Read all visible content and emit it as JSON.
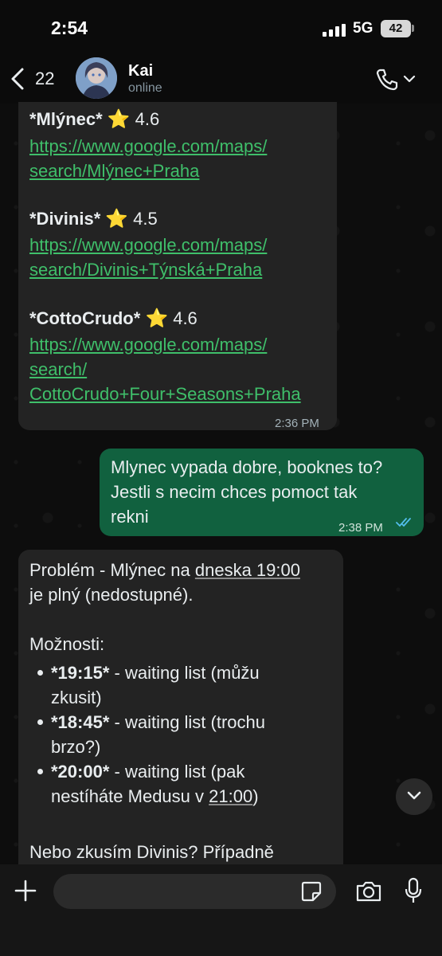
{
  "status_bar": {
    "time": "2:54",
    "network": "5G",
    "battery": "42"
  },
  "header": {
    "back_count": "22",
    "contact_name": "Kai",
    "contact_status": "online"
  },
  "messages": [
    {
      "direction": "incoming",
      "entries": [
        {
          "name": "*Mlýnec*",
          "star": "⭐",
          "rating": "4.6",
          "link_lines": [
            "https://www.google.com/maps/",
            "search/Mlýnec+Praha"
          ]
        },
        {
          "name": "*Divinis*",
          "star": "⭐",
          "rating": "4.5",
          "link_lines": [
            "https://www.google.com/maps/",
            "search/Divinis+Týnská+Praha"
          ]
        },
        {
          "name": "*CottoCrudo*",
          "star": "⭐",
          "rating": "4.6",
          "link_lines": [
            "https://www.google.com/maps/",
            "search/",
            "CottoCrudo+Four+Seasons+Praha"
          ]
        }
      ],
      "time": "2:36 PM"
    },
    {
      "direction": "outgoing",
      "lines": [
        "Mlynec vypada dobre, booknes to?",
        "Jestli s necim chces pomoct tak",
        "rekni"
      ],
      "time": "2:38 PM",
      "status": "read"
    },
    {
      "direction": "incoming",
      "intro_prefix": "Problém - Mlýnec na ",
      "intro_link": "dneska 19:00",
      "intro_line2": "je plný (nedostupné).",
      "options_label": "Možnosti:",
      "options": [
        {
          "time": "*19:15*",
          "line1": " - waiting list (můžu",
          "line2": "zkusit)"
        },
        {
          "time": "*18:45*",
          "line1": " - waiting list (trochu",
          "line2": "brzo?)"
        },
        {
          "time": "*20:00*",
          "line1": " - waiting list (pak",
          "line2_prefix": "nestíháte Medusu v ",
          "line2_link": "21:00",
          "line2_suffix": ")"
        }
      ],
      "trailing": "Nebo zkusím Divinis? Případně"
    }
  ],
  "composer": {
    "placeholder": ""
  },
  "colors": {
    "outgoing_bubble": "#11613f",
    "incoming_bubble": "#232323",
    "link": "#3fbf6a",
    "read_ticks": "#53bdeb"
  }
}
